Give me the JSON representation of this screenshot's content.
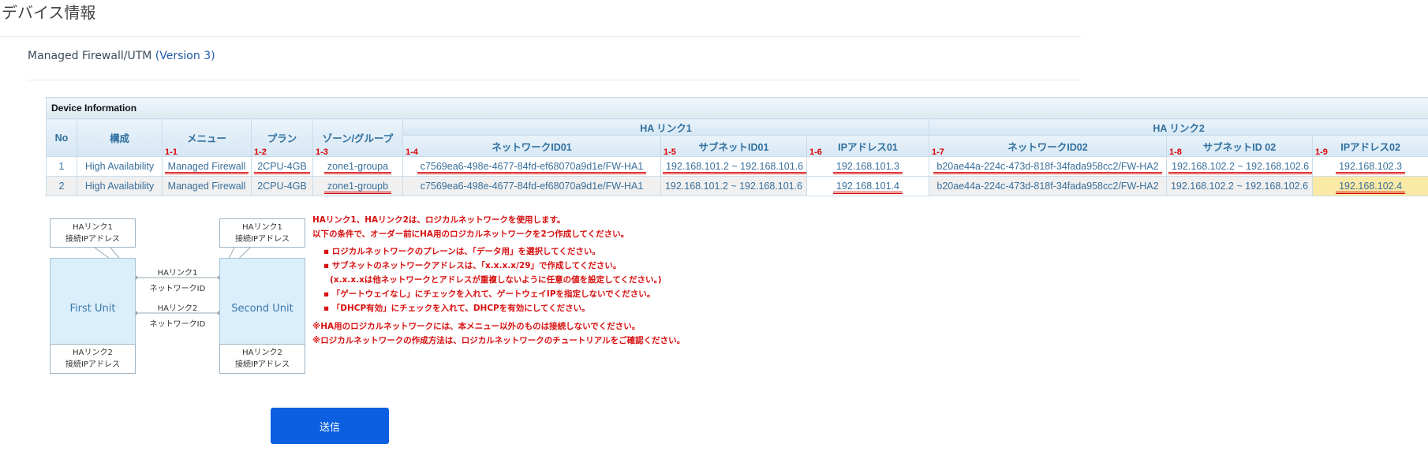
{
  "page": {
    "title": "デバイス情報",
    "subtitle": "Managed Firewall/UTM ",
    "version": "(Version 3)"
  },
  "table": {
    "caption": "Device Information",
    "headers": {
      "no": "No",
      "config": "構成",
      "menu": "メニュー",
      "plan": "プラン",
      "zone": "ゾーン/グループ",
      "ha1": "HA リンク1",
      "ha2": "HA リンク2",
      "net1": "ネットワークID01",
      "sub1": "サブネットID01",
      "ip1": "IPアドレス01",
      "net2": "ネットワークID02",
      "sub2": "サブネットID 02",
      "ip2": "IPアドレス02"
    },
    "markers": [
      "1-1",
      "1-2",
      "1-3",
      "1-4",
      "1-5",
      "1-6",
      "1-7",
      "1-8",
      "1-9"
    ],
    "rows": [
      {
        "no": "1",
        "config": "High Availability",
        "menu": "Managed Firewall",
        "plan": "2CPU-4GB",
        "zone": "zone1-groupa",
        "net1": "c7569ea6-498e-4677-84fd-ef68070a9d1e/FW-HA1",
        "sub1": "192.168.101.2 ~ 192.168.101.6",
        "ip1": "192.168.101.3",
        "net2": "b20ae44a-224c-473d-818f-34fada958cc2/FW-HA2",
        "sub2": "192.168.102.2 ~ 192.168.102.6",
        "ip2": "192.168.102.3"
      },
      {
        "no": "2",
        "config": "High Availability",
        "menu": "Managed Firewall",
        "plan": "2CPU-4GB",
        "zone": "zone1-groupb",
        "net1": "c7569ea6-498e-4677-84fd-ef68070a9d1e/FW-HA1",
        "sub1": "192.168.101.2 ~ 192.168.101.6",
        "ip1": "192.168.101.4",
        "net2": "b20ae44a-224c-473d-818f-34fada958cc2/FW-HA2",
        "sub2": "192.168.102.2 ~ 192.168.102.6",
        "ip2": "192.168.102.4"
      }
    ]
  },
  "diagram": {
    "ha1_ip_a": "HAリンク1",
    "ha1_ip_b": "接続IPアドレス",
    "ha2_ip_a": "HAリンク2",
    "ha2_ip_b": "接続IPアドレス",
    "first": "First Unit",
    "second": "Second Unit",
    "link1": "HAリンク1",
    "link2": "HAリンク2",
    "netid": "ネットワークID"
  },
  "notes": [
    "HAリンク1、HAリンク2は、ロジカルネットワークを使用します。",
    "以下の条件で、オーダー前にHA用のロジカルネットワークを2つ作成してください。",
    "▪ ロジカルネットワークのプレーンは、「データ用」を選択してください。",
    "▪ サブネットのネットワークアドレスは、「x.x.x.x/29」で作成してください。",
    "(x.x.x.xは他ネットワークとアドレスが重複しないように任意の値を設定してください。)",
    "▪ 「ゲートウェイなし」にチェックを入れて、ゲートウェイIPを指定しないでください。",
    "▪ 「DHCP有効」にチェックを入れて、DHCPを有効にしてください。",
    "※HA用のロジカルネットワークには、本メニュー以外のものは接続しないでください。",
    "※ロジカルネットワークの作成方法は、ロジカルネットワークのチュートリアルをご確認ください。"
  ],
  "submit": "送信",
  "colors": {
    "accent": "#0b5fe0",
    "annotation": "#d40000",
    "highlight": "#fbe9a6"
  }
}
